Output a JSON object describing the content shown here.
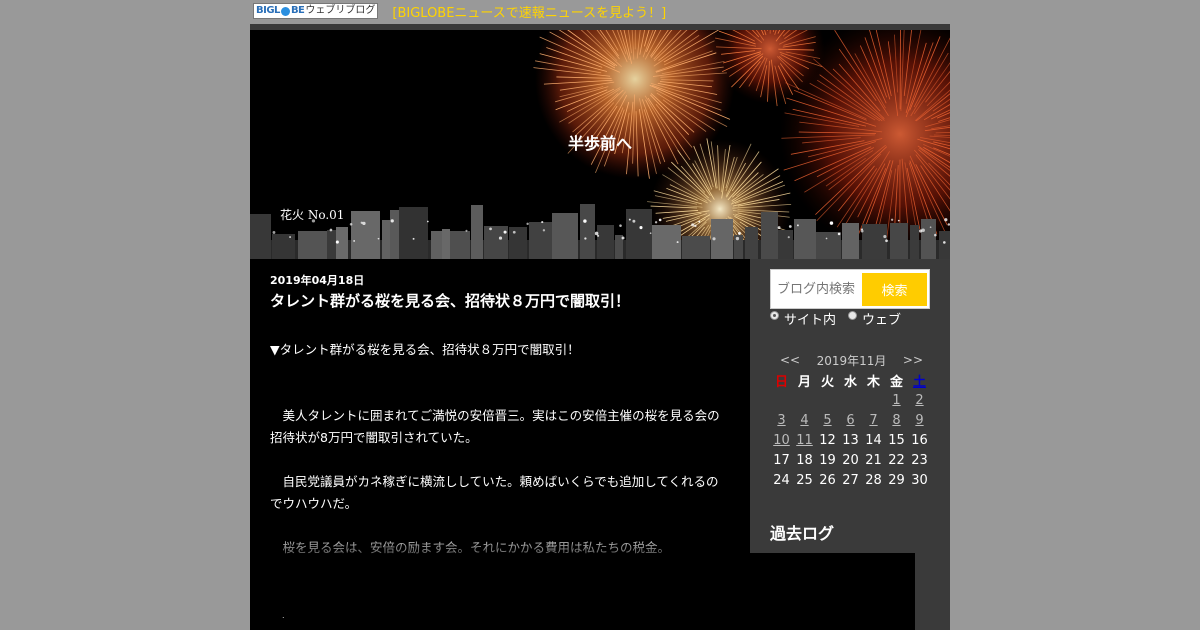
{
  "topbar": {
    "logo_text_1": "BIGL",
    "logo_text_2": "BE",
    "logo_text_3": "ウェブリブログ",
    "news_link": "[BIGLOBEニュースで速報ニュースを見よう！]"
  },
  "header": {
    "blog_title": "半歩前へ",
    "caption": "花火 No.01"
  },
  "post": {
    "date": "2019年04月18日",
    "title": "タレント群がる桜を見る会、招待状８万円で闇取引！",
    "paragraphs": [
      "▼タレント群がる桜を見る会、招待状８万円で闇取引！",
      "",
      "",
      "　美人タレントに囲まれてご満悦の安倍晋三。実はこの安倍主催の桜を見る会の招待状が8万円で闇取引されていた。",
      "",
      "　自民党議員がカネ稼ぎに横流ししていた。頼めばいくらでも追加してくれるのでウハウハだ。",
      "",
      "　桜を見る会は、安倍の励ます会。それにかかる費用は私たちの税金。"
    ],
    "trailing_mark": "."
  },
  "search": {
    "placeholder": "ブログ内検索",
    "button": "検索",
    "option_site": "サイト内",
    "option_web": "ウェブ",
    "selected": "サイト内"
  },
  "calendar": {
    "prev": "<<",
    "title": "2019年11月",
    "next": ">>",
    "days_of_week": [
      "日",
      "月",
      "火",
      "水",
      "木",
      "金",
      "土"
    ],
    "weeks": [
      [
        "",
        "",
        "",
        "",
        "",
        "1",
        "2"
      ],
      [
        "3",
        "4",
        "5",
        "6",
        "7",
        "8",
        "9"
      ],
      [
        "10",
        "11",
        "12",
        "13",
        "14",
        "15",
        "16"
      ],
      [
        "17",
        "18",
        "19",
        "20",
        "21",
        "22",
        "23"
      ],
      [
        "24",
        "25",
        "26",
        "27",
        "28",
        "29",
        "30"
      ]
    ],
    "linked_days": [
      "1",
      "2",
      "3",
      "4",
      "5",
      "6",
      "7",
      "8",
      "9",
      "10",
      "11"
    ]
  },
  "archive": {
    "heading": "過去ログ"
  },
  "colors": {
    "page_bg": "#999999",
    "sidebar_bg": "#3a3a3a",
    "content_bg": "#000000",
    "accent_yellow": "#ffcc00",
    "link_yellow": "#ffd400",
    "sunday_red": "#dd0000",
    "saturday_blue": "#0000cc"
  }
}
